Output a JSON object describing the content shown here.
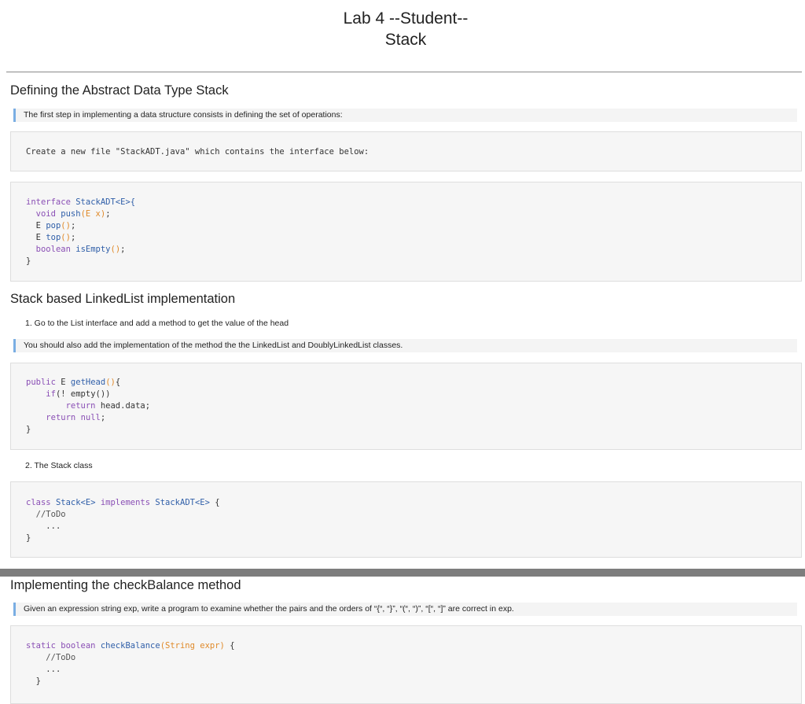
{
  "title": {
    "line1": "Lab 4 --Student--",
    "line2": "Stack"
  },
  "sections": {
    "s1": {
      "heading": "Defining the Abstract Data Type Stack",
      "note": "The first step in implementing a data structure consists in defining the set of operations:",
      "instruction": "Create a new file \"StackADT.java\" which contains the interface below:",
      "code": {
        "l1_kw": "interface",
        "l1_name": "StackADT<E>{",
        "l2_kw": "void",
        "l2_fn": "push",
        "l2_par": "(E x)",
        "l2_end": ";",
        "l3_t": "E",
        "l3_fn": "pop",
        "l3_par": "()",
        "l3_end": ";",
        "l4_t": "E",
        "l4_fn": "top",
        "l4_par": "()",
        "l4_end": ";",
        "l5_kw": "boolean",
        "l5_fn": "isEmpty",
        "l5_par": "()",
        "l5_end": ";",
        "l6": "}"
      }
    },
    "s2": {
      "heading": "Stack based LinkedList implementation",
      "item1": "1. Go to the List interface and add a method to get the value of the head",
      "note": "You should also add the implementation of the method the the LinkedList and DoublyLinkedList classes.",
      "code": {
        "l1_kw": "public",
        "l1_t": "E",
        "l1_fn": "getHead",
        "l1_par": "()",
        "l1_end": "{",
        "l2_kw": "if",
        "l2_rest": "(! empty())",
        "l3_kw": "return",
        "l3_rest": "head.data;",
        "l4_kw": "return",
        "l4_null": "null",
        "l4_end": ";",
        "l5": "}"
      },
      "item2": "2. The Stack class",
      "code2": {
        "l1_kw": "class",
        "l1_name": "Stack<E>",
        "l1_kw2": "implements",
        "l1_name2": "StackADT<E>",
        "l1_end": "{",
        "l2": "//ToDo",
        "l3": "...",
        "l4": "}"
      }
    },
    "s3": {
      "heading": "Implementing the checkBalance method",
      "note": "Given an expression string exp, write a program to examine whether the pairs and the orders of “{“, “}”, “(“, “)”, “[“, “]” are correct in exp.",
      "code": {
        "l1_kw": "static boolean",
        "l1_fn": "checkBalance",
        "l1_par": "(String expr)",
        "l1_end": "{",
        "l2": "//ToDo",
        "l3": "...",
        "l4": "}"
      }
    }
  }
}
